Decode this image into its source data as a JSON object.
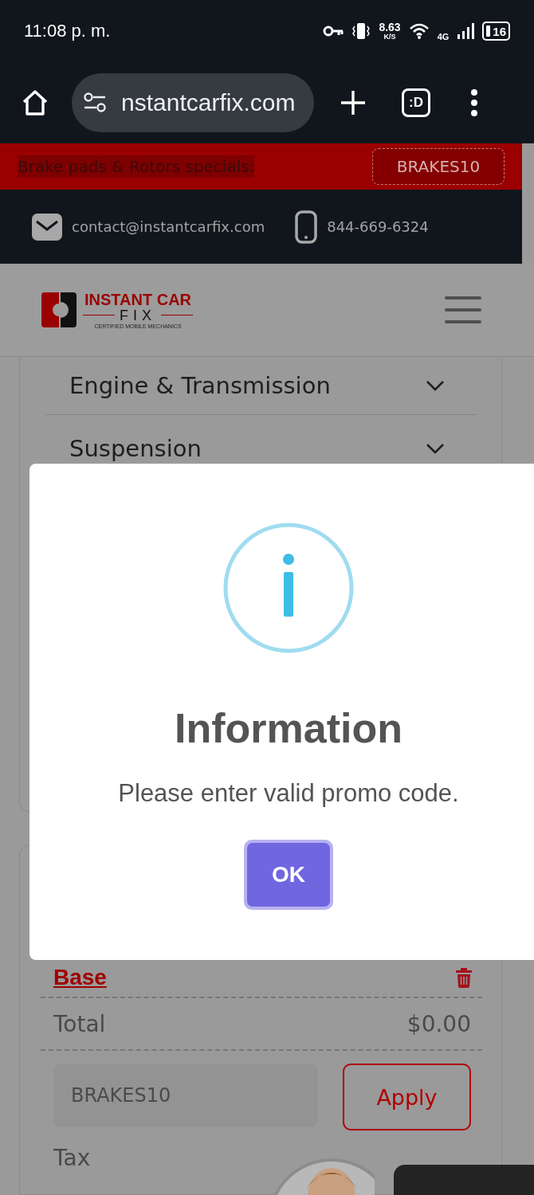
{
  "status_bar": {
    "time": "11:08 p. m.",
    "net_speed": "8.63",
    "net_speed_unit": "K/S",
    "network": "4G",
    "battery": "16"
  },
  "browser": {
    "url": "nstantcarfix.com",
    "tab_switcher": ":D"
  },
  "promo_bar": {
    "text": "Brake pads & Rotors specials:",
    "code": "BRAKES10"
  },
  "contact_bar": {
    "email": "contact@instantcarfix.com",
    "phone": "844-669-6324"
  },
  "logo": {
    "line1": "INSTANT CAR",
    "line2": "FIX",
    "tagline": "CERTIFIED MOBILE MECHANICS"
  },
  "services": [
    {
      "label": "Engine & Transmission",
      "expanded": false
    },
    {
      "label": "Suspension",
      "expanded": false
    }
  ],
  "cart": {
    "item": "Base",
    "total_label": "Total",
    "total": "$0.00",
    "promo_value": "BRAKES10",
    "apply": "Apply",
    "tax_label": "Tax"
  },
  "dialog": {
    "title": "Information",
    "message": "Please enter valid promo code.",
    "button": "OK"
  }
}
